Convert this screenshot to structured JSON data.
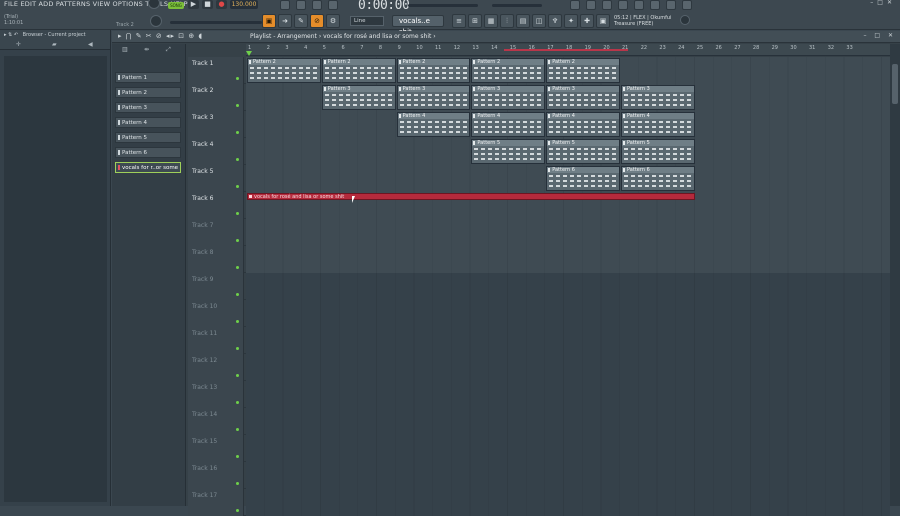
{
  "menu": "FILE  EDIT  ADD  PATTERNS  VIEW  OPTIONS  TOOLS  HELP",
  "trial_lines": [
    "(Trial)",
    "1:10:01"
  ],
  "track_hint": "Track 2",
  "song_led": "SONG",
  "tempo": "130.000",
  "time_display": "0:00:00",
  "snap_value": "Line",
  "pattern_selector": "vocals..e shit",
  "cpu_info": [
    "05:12 | FLEX | Okumfui",
    "Treasure (FREE)"
  ],
  "browser": {
    "label": "Browser - Current project"
  },
  "playlist": {
    "breadcrumb": "Playlist - Arrangement › vocals for rosé and lisa or some shit ›",
    "window_controls": "– □ ✕"
  },
  "patterns": [
    {
      "label": "Pattern 1"
    },
    {
      "label": "Pattern 2"
    },
    {
      "label": "Pattern 3"
    },
    {
      "label": "Pattern 4"
    },
    {
      "label": "Pattern 5"
    },
    {
      "label": "Pattern 6"
    },
    {
      "label": "vocals for r..or some shit",
      "selected": true
    }
  ],
  "ruler": [
    "1",
    "2",
    "3",
    "4",
    "5",
    "6",
    "7",
    "8",
    "9",
    "10",
    "11",
    "12",
    "13",
    "14",
    "15",
    "16",
    "17",
    "18",
    "19",
    "20",
    "21",
    "22",
    "23",
    "24",
    "25",
    "26",
    "27",
    "28",
    "29",
    "30",
    "31",
    "32",
    "33"
  ],
  "tracks": [
    {
      "label": "Track 1",
      "clips": [
        {
          "label": "Pattern 2",
          "start": 1,
          "len": 4
        },
        {
          "label": "Pattern 2",
          "start": 5,
          "len": 4
        },
        {
          "label": "Pattern 2",
          "start": 9,
          "len": 4
        },
        {
          "label": "Pattern 2",
          "start": 13,
          "len": 4
        },
        {
          "label": "Pattern 2",
          "start": 17,
          "len": 4
        }
      ]
    },
    {
      "label": "Track 2",
      "clips": [
        {
          "label": "Pattern 3",
          "start": 5,
          "len": 4
        },
        {
          "label": "Pattern 3",
          "start": 9,
          "len": 4
        },
        {
          "label": "Pattern 3",
          "start": 13,
          "len": 4
        },
        {
          "label": "Pattern 3",
          "start": 17,
          "len": 4
        },
        {
          "label": "Pattern 3",
          "start": 21,
          "len": 4
        }
      ]
    },
    {
      "label": "Track 3",
      "clips": [
        {
          "label": "Pattern 4",
          "start": 9,
          "len": 4
        },
        {
          "label": "Pattern 4",
          "start": 13,
          "len": 4
        },
        {
          "label": "Pattern 4",
          "start": 17,
          "len": 4
        },
        {
          "label": "Pattern 4",
          "start": 21,
          "len": 4
        }
      ]
    },
    {
      "label": "Track 4",
      "clips": [
        {
          "label": "Pattern 5",
          "start": 13,
          "len": 4
        },
        {
          "label": "Pattern 5",
          "start": 17,
          "len": 4
        },
        {
          "label": "Pattern 5",
          "start": 21,
          "len": 4
        }
      ]
    },
    {
      "label": "Track 5",
      "clips": [
        {
          "label": "Pattern 6",
          "start": 17,
          "len": 4
        },
        {
          "label": "Pattern 6",
          "start": 21,
          "len": 4
        }
      ]
    },
    {
      "label": "Track 6",
      "audio": {
        "label": "vocals for rosé and lisa or some shit",
        "start": 1,
        "len": 24
      }
    },
    {
      "label": "Track 7"
    },
    {
      "label": "Track 8"
    },
    {
      "label": "Track 9"
    },
    {
      "label": "Track 10"
    },
    {
      "label": "Track 11"
    },
    {
      "label": "Track 12"
    },
    {
      "label": "Track 13"
    },
    {
      "label": "Track 14"
    },
    {
      "label": "Track 15"
    },
    {
      "label": "Track 16"
    },
    {
      "label": "Track 17"
    }
  ]
}
